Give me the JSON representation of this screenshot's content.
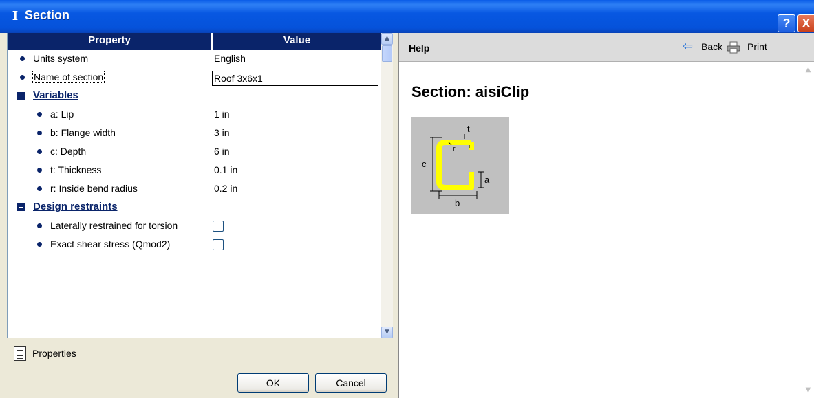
{
  "window": {
    "title": "Section",
    "help_button": "?",
    "close_button": "X"
  },
  "grid": {
    "header_property": "Property",
    "header_value": "Value",
    "rows": [
      {
        "label": "Units system",
        "value": "English"
      },
      {
        "label": "Name of section",
        "value": "Roof 3x6x1"
      }
    ],
    "variables_group": "Variables",
    "variables": [
      {
        "label": "a: Lip",
        "value": "1 in"
      },
      {
        "label": "b: Flange width",
        "value": "3 in"
      },
      {
        "label": "c: Depth",
        "value": "6 in"
      },
      {
        "label": "t: Thickness",
        "value": "0.1 in"
      },
      {
        "label": "r: Inside bend radius",
        "value": "0.2 in"
      }
    ],
    "restraints_group": "Design restraints",
    "restraints": [
      {
        "label": "Laterally restrained for torsion",
        "checked": false
      },
      {
        "label": "Exact shear stress (Qmod2)",
        "checked": false
      }
    ]
  },
  "properties_tab": "Properties",
  "buttons": {
    "ok": "OK",
    "cancel": "Cancel"
  },
  "help": {
    "title": "Help",
    "back": "Back",
    "print": "Print",
    "heading": "Section: aisiClip",
    "figure_labels": {
      "t": "t",
      "r": "r",
      "c": "c",
      "a": "a",
      "b": "b"
    }
  },
  "colors": {
    "titlebar": "#0552da",
    "grid_header": "#0a246a",
    "section_shape": "#ffff00",
    "figure_background": "#c0c0c0"
  }
}
